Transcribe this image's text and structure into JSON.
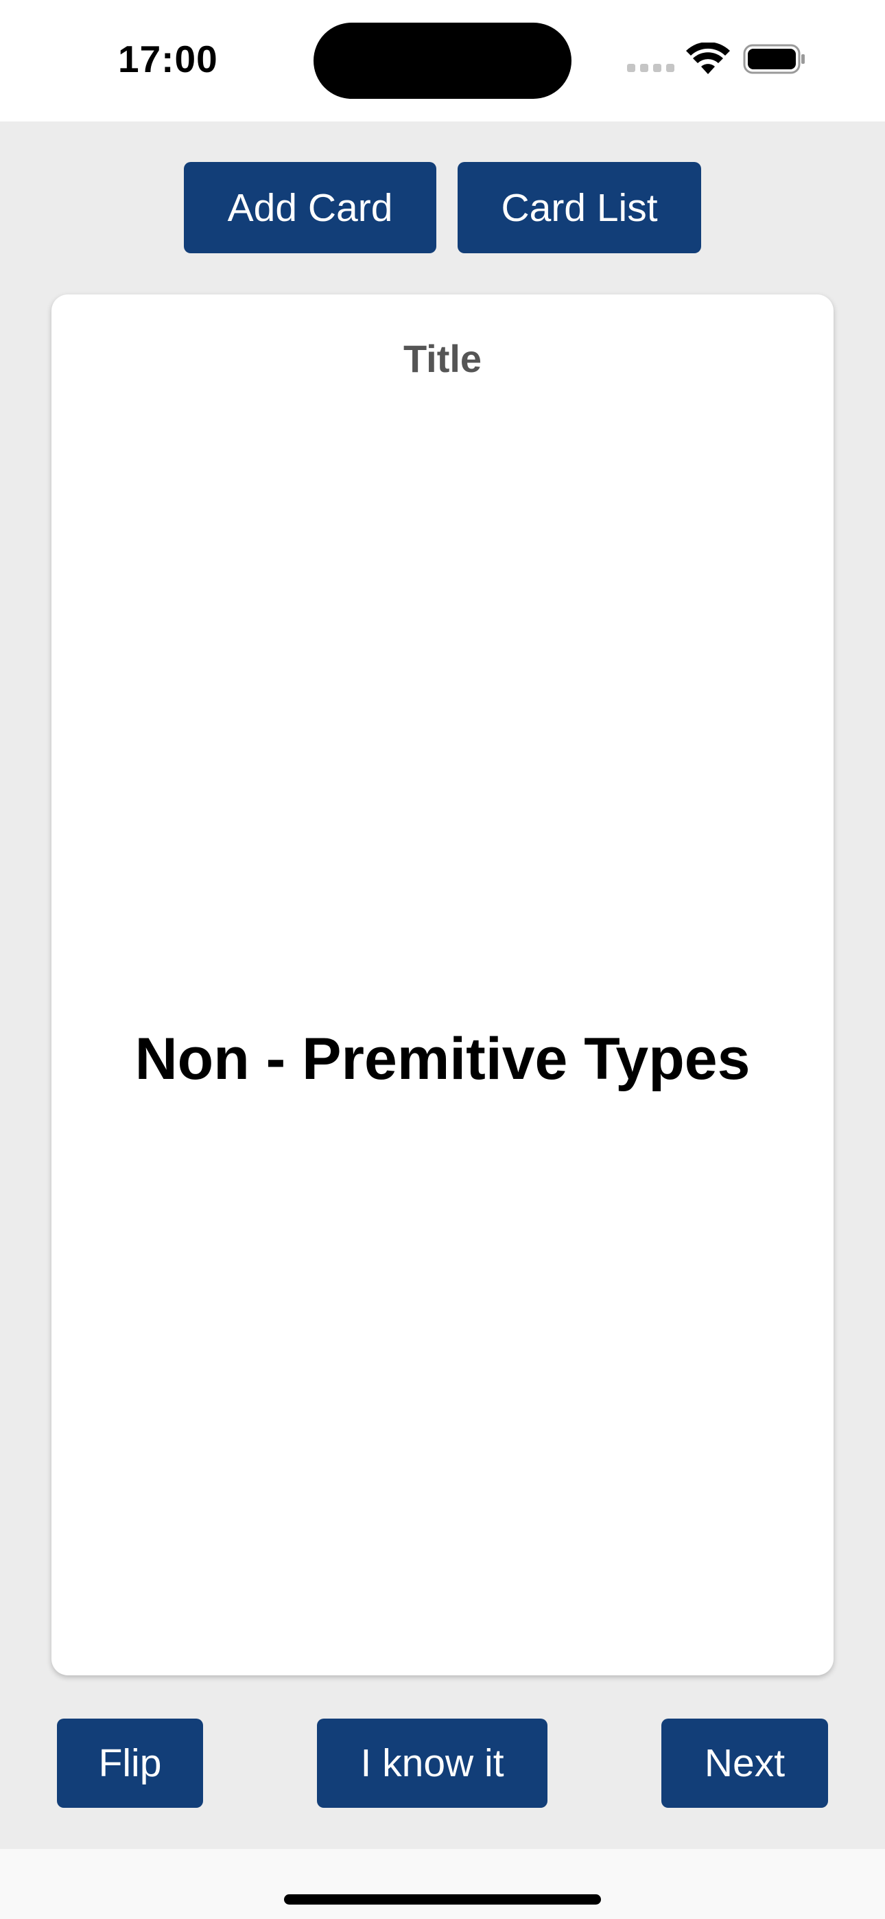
{
  "status_bar": {
    "time": "17:00",
    "icons": [
      "signal-icon",
      "wifi-icon",
      "battery-icon"
    ]
  },
  "toolbar": {
    "add_card_label": "Add Card",
    "card_list_label": "Card List"
  },
  "card": {
    "title": "Title",
    "text": "Non - Premitive Types"
  },
  "actions": {
    "flip_label": "Flip",
    "know_label": "I know it",
    "next_label": "Next"
  },
  "colors": {
    "accent": "#123e78",
    "background": "#ececec",
    "card": "#ffffff",
    "title_text": "#555555"
  }
}
